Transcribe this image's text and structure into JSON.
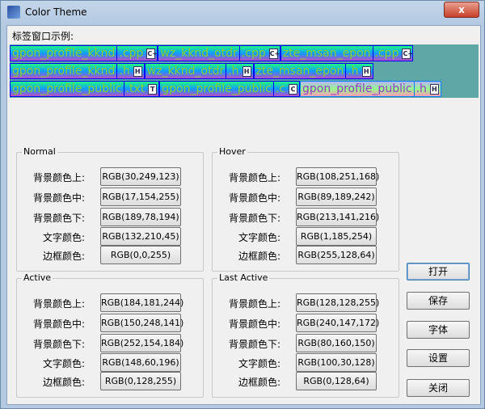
{
  "window": {
    "title": "Color Theme",
    "close": "x"
  },
  "preview_label": "标签窗口示例:",
  "tab_rows": [
    [
      {
        "name": "gpon_profile_kknd",
        "ext": ".cpp",
        "icon": "C+"
      },
      {
        "name": "wz_kknd_otdr",
        "ext": ".cpp",
        "icon": "C+"
      },
      {
        "name": "zte_msan_epon",
        "ext": ".cpp",
        "icon": "C+"
      }
    ],
    [
      {
        "name": "gpon_profile_kknd",
        "ext": ".h",
        "icon": "H"
      },
      {
        "name": "wz_kknd_otdr",
        "ext": ".h",
        "icon": "H"
      },
      {
        "name": "zte_msan_epon",
        "ext": ".h",
        "icon": "H"
      }
    ],
    [
      {
        "name": "gpon_profile_public",
        "ext": ".txt",
        "icon": "T"
      },
      {
        "name": "gpon_profile_public",
        "ext": ".c",
        "icon": "C"
      },
      {
        "name": "gpon_profile_public",
        "ext": ".h",
        "icon": "H",
        "active": true
      }
    ]
  ],
  "row_labels": [
    "背景颜色上:",
    "背景颜色中:",
    "背景颜色下:",
    "文字颜色:",
    "边框颜色:"
  ],
  "groups": {
    "normal": {
      "title": "Normal",
      "values": [
        "RGB(30,249,123)",
        "RGB(17,154,255)",
        "RGB(189,78,194)",
        "RGB(132,210,45)",
        "RGB(0,0,255)"
      ]
    },
    "hover": {
      "title": "Hover",
      "values": [
        "RGB(108,251,168)",
        "RGB(89,189,242)",
        "RGB(213,141,216)",
        "RGB(1,185,254)",
        "RGB(255,128,64)"
      ]
    },
    "active": {
      "title": "Active",
      "values": [
        "RGB(184,181,244)",
        "RGB(150,248,141)",
        "RGB(252,154,184)",
        "RGB(148,60,196)",
        "RGB(0,128,255)"
      ]
    },
    "last_active": {
      "title": "Last Active",
      "values": [
        "RGB(128,128,255)",
        "RGB(240,147,172)",
        "RGB(80,160,150)",
        "RGB(100,30,128)",
        "RGB(0,128,64)"
      ]
    }
  },
  "buttons": {
    "open": "打开",
    "save": "保存",
    "font": "字体",
    "settings": "设置",
    "close": "关闭"
  }
}
